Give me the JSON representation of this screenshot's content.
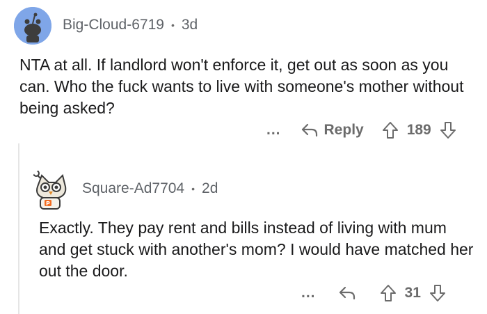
{
  "comment": {
    "username": "Big-Cloud-6719",
    "separator": "•",
    "age": "3d",
    "text": "NTA at all. If landlord won't enforce it, get out as soon as you can. Who the fuck wants to live with someone's mother without being asked?",
    "actions": {
      "more": "...",
      "reply_label": "Reply",
      "score": "189"
    },
    "icons": {
      "avatar": "reddit-snoo-avatar",
      "reply": "reply-arrow-icon",
      "upvote": "upvote-arrow-icon",
      "downvote": "downvote-arrow-icon"
    },
    "colors": {
      "avatar_bg": "#7fa6e8"
    }
  },
  "reply": {
    "username": "Square-Ad7704",
    "separator": "•",
    "age": "2d",
    "text": "Exactly. They pay rent and bills instead of living with mum and get stuck with another's mom? I would have matched her out the door.",
    "actions": {
      "more": "...",
      "score": "31"
    },
    "icons": {
      "avatar": "snoo-owl-costume-avatar",
      "reply": "reply-arrow-icon",
      "upvote": "upvote-arrow-icon",
      "downvote": "downvote-arrow-icon"
    }
  }
}
